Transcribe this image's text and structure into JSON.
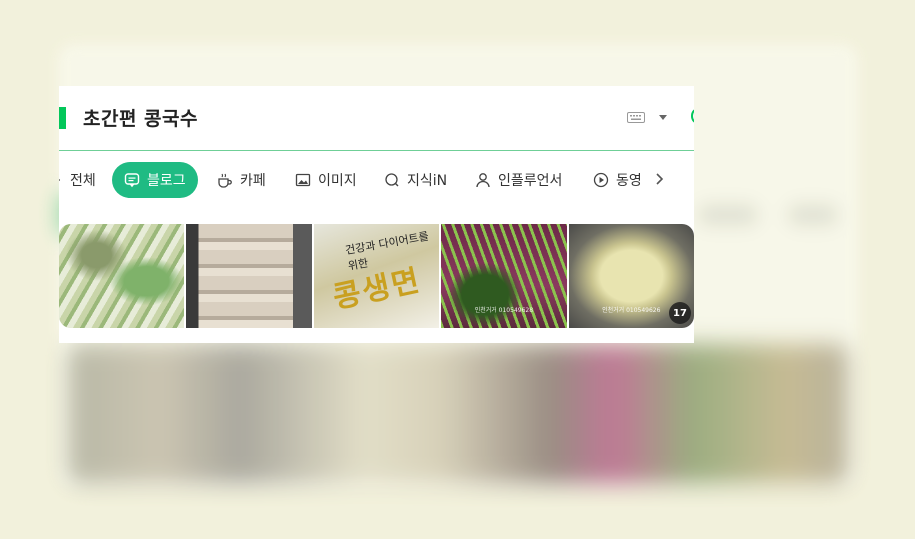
{
  "search": {
    "query": "초간편 콩국수"
  },
  "tabs": [
    {
      "label": "전체",
      "icon": "all-icon"
    },
    {
      "label": "블로그",
      "icon": "blog-icon",
      "active": true
    },
    {
      "label": "카페",
      "icon": "cafe-icon"
    },
    {
      "label": "이미지",
      "icon": "image-icon"
    },
    {
      "label": "지식iN",
      "icon": "kin-icon"
    },
    {
      "label": "인플루언서",
      "icon": "influencer-icon"
    },
    {
      "label": "동영",
      "icon": "video-icon"
    }
  ],
  "thumbnails": {
    "t3_overlay_text": "콩생면",
    "t3_small_text": "건강과 다이어트를 위한",
    "t4_watermark": "인천거거 010549628",
    "t5_watermark": "인천거거 010549626",
    "more_count": "17"
  },
  "colors": {
    "accent": "#03c75a",
    "active_tab": "#1fbb83",
    "background": "#f2f1dc"
  }
}
